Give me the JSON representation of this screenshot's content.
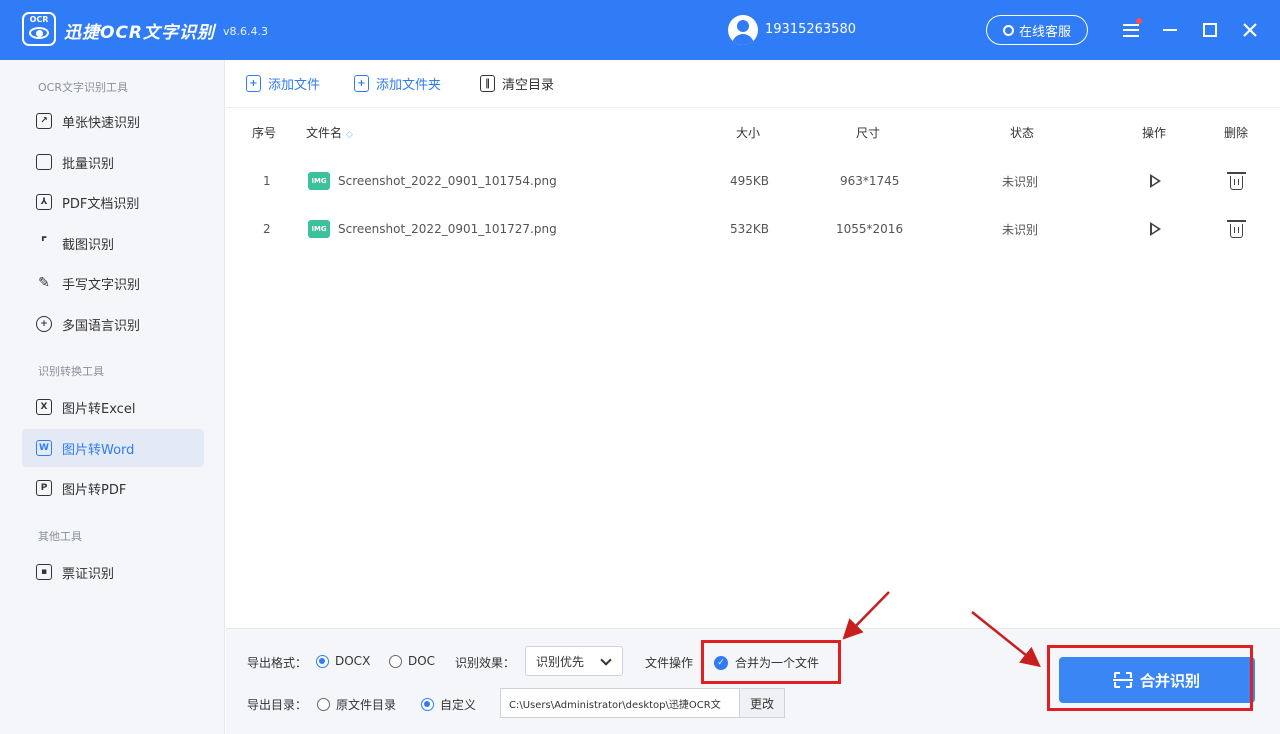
{
  "titlebar": {
    "app_title": "迅捷OCR文字识别",
    "version": "v8.6.4.3",
    "logo_text": "OCR",
    "account": "19315263580",
    "support_label": "在线客服"
  },
  "sidebar": {
    "sections": [
      {
        "label": "OCR文字识别工具"
      },
      {
        "label": "识别转换工具"
      },
      {
        "label": "其他工具"
      }
    ],
    "items": [
      {
        "label": "单张快速识别",
        "icon": "edit-image-icon"
      },
      {
        "label": "批量识别",
        "icon": "copy-icon"
      },
      {
        "label": "PDF文档识别",
        "icon": "pdf-doc-icon"
      },
      {
        "label": "截图识别",
        "icon": "crop-icon"
      },
      {
        "label": "手写文字识别",
        "icon": "pen-icon"
      },
      {
        "label": "多国语言识别",
        "icon": "globe-icon"
      },
      {
        "label": "图片转Excel",
        "icon": "excel-icon",
        "glyph": "X"
      },
      {
        "label": "图片转Word",
        "icon": "word-icon",
        "glyph": "W"
      },
      {
        "label": "图片转PDF",
        "icon": "pdf-icon",
        "glyph": "P"
      },
      {
        "label": "票证识别",
        "icon": "id-card-icon"
      }
    ],
    "active_item": "图片转Word"
  },
  "toolbar": {
    "add_file": "添加文件",
    "add_folder": "添加文件夹",
    "clear_list": "清空目录"
  },
  "table": {
    "headers": {
      "index": "序号",
      "filename": "文件名",
      "sort_glyph": "◇",
      "size": "大小",
      "dimensions": "尺寸",
      "status": "状态",
      "action": "操作",
      "delete": "删除"
    },
    "file_icon_text": "IMG",
    "rows": [
      {
        "index": "1",
        "filename": "Screenshot_2022_0901_101754.png",
        "size": "495KB",
        "dimensions": "963*1745",
        "status": "未识别"
      },
      {
        "index": "2",
        "filename": "Screenshot_2022_0901_101727.png",
        "size": "532KB",
        "dimensions": "1055*2016",
        "status": "未识别"
      }
    ]
  },
  "bottom": {
    "export_format_label": "导出格式：",
    "format_docx": "DOCX",
    "format_doc": "DOC",
    "selected_format": "DOCX",
    "effect_label": "识别效果：",
    "effect_value": "识别优先",
    "file_op_label": "文件操作",
    "merge_label": "合并为一个文件",
    "merge_checked": true,
    "export_dir_label": "导出目录：",
    "dir_original": "原文件目录",
    "dir_custom": "自定义",
    "selected_dir": "自定义",
    "path_value": "C:\\Users\\Administrator\\desktop\\迅捷OCR文",
    "change_label": "更改",
    "primary_label": "合并识别"
  },
  "colors": {
    "brand": "#2f7cf6",
    "annotation": "#e02020",
    "file_icon": "#3cc19a"
  }
}
